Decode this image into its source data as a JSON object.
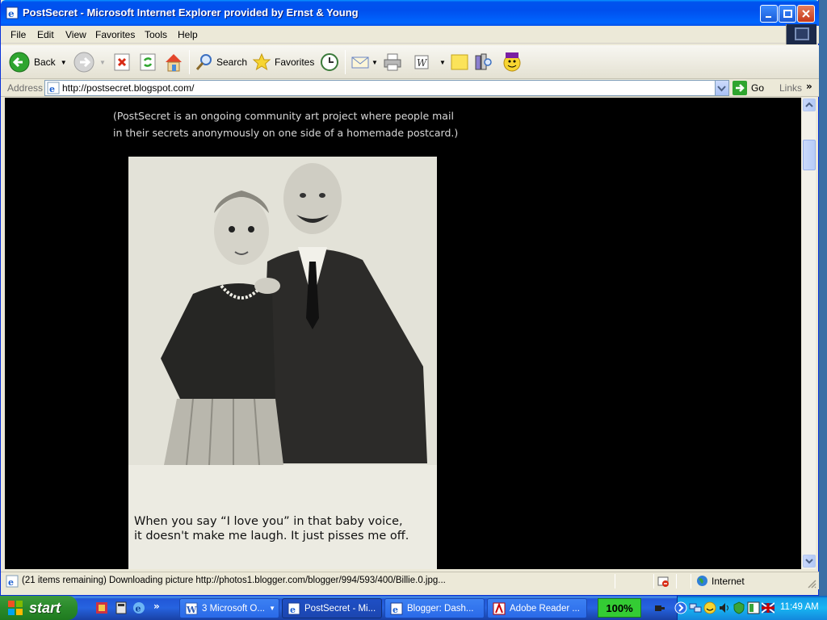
{
  "window": {
    "title": "PostSecret - Microsoft Internet Explorer provided by Ernst & Young"
  },
  "menu": [
    "File",
    "Edit",
    "View",
    "Favorites",
    "Tools",
    "Help"
  ],
  "toolbar": {
    "back_label": "Back",
    "search_label": "Search",
    "favorites_label": "Favorites"
  },
  "address": {
    "label": "Address",
    "url": "http://postsecret.blogspot.com/",
    "go_label": "Go",
    "links_label": "Links",
    "links_chevron": "»"
  },
  "page": {
    "intro": "(PostSecret is an ongoing community art project where people mail in their secrets anonymously on one side of a homemade postcard.)",
    "caption_line1": "When you say “I love you” in that baby voice,",
    "caption_line2": "it doesn't make me laugh.  It just pisses me off."
  },
  "status": {
    "text": "(21 items remaining) Downloading picture http://photos1.blogger.com/blogger/994/593/400/Billie.0.jpg...",
    "zone": "Internet"
  },
  "taskbar": {
    "start_label": "start",
    "tasks": [
      {
        "label": "3 Microsoft O...",
        "icon": "word-icon"
      },
      {
        "label": "PostSecret - Mi...",
        "icon": "ie-icon"
      },
      {
        "label": "Blogger: Dash...",
        "icon": "ie-icon"
      },
      {
        "label": "Adobe Reader ...",
        "icon": "adobe-reader-icon"
      }
    ],
    "zoom": "100%",
    "clock": "11:49 AM"
  },
  "colors": {
    "page_bg": "#000000",
    "intro_text": "#d8d8d8",
    "title_bar": "#0053ee",
    "start_green": "#2a8a2a"
  }
}
